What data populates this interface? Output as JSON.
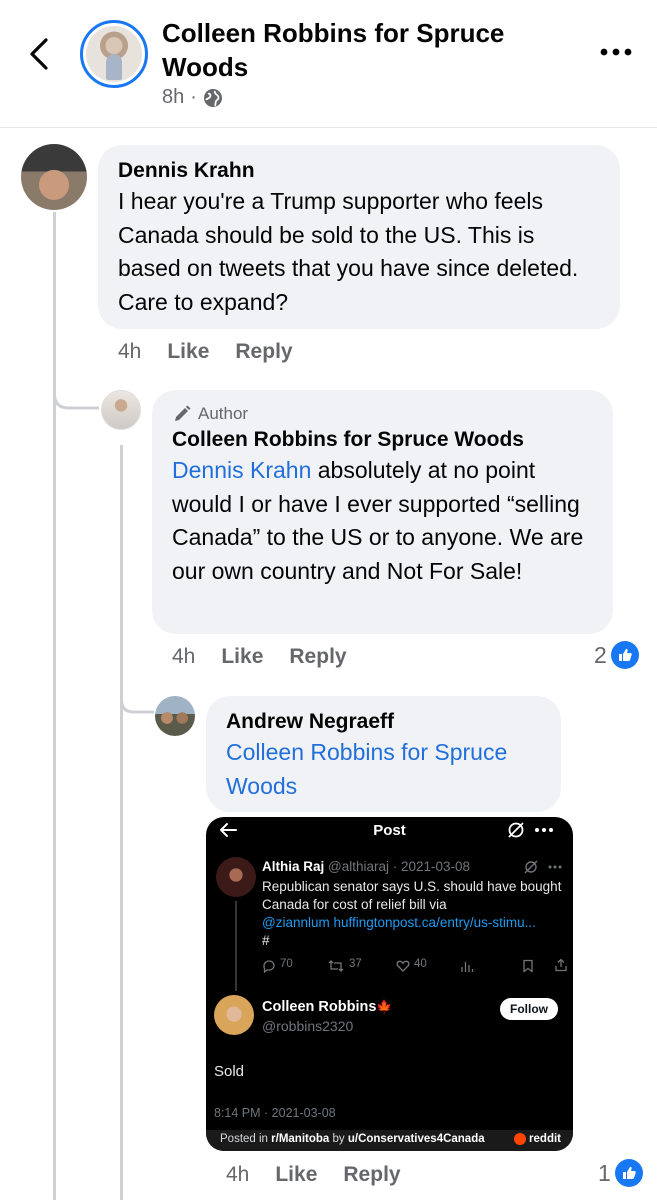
{
  "header": {
    "title": "Colleen Robbins for Spruce Woods",
    "time": "8h",
    "dot": "·"
  },
  "comments": [
    {
      "name": "Dennis Krahn",
      "text": "I hear you're a Trump supporter who feels Canada should be sold to the US. This is based on tweets that you have since deleted. Care to expand?",
      "time": "4h",
      "like": "Like",
      "reply": "Reply"
    },
    {
      "badge": "Author",
      "name": "Colleen Robbins for Spruce Woods",
      "mention": "Dennis Krahn",
      "text": " absolutely at no point would I or have I ever supported “selling Canada” to the US or to anyone. We are our own country and Not For Sale!",
      "time": "4h",
      "like": "Like",
      "reply": "Reply",
      "reaction_count": "2"
    },
    {
      "name": "Andrew Negraeff",
      "mention": "Colleen Robbins for Spruce Woods",
      "time": "4h",
      "like": "Like",
      "reply": "Reply",
      "reaction_count": "1"
    }
  ],
  "embedded": {
    "title": "Post",
    "tweet": {
      "name": "Althia Raj",
      "handle": "@althiaraj · 2021-03-08",
      "text": "Republican senator says U.S. should have bought Canada for cost of relief bill via",
      "link": "@ziannlum huffingtonpost.ca/entry/us-stimu...",
      "hash": "#",
      "replies": "70",
      "retweets": "37",
      "likes": "40"
    },
    "reply": {
      "name": "Colleen Robbins",
      "flag": "🍁",
      "handle": "@robbins2320",
      "follow": "Follow",
      "text": "Sold",
      "date": "8:14 PM · 2021-03-08"
    },
    "reddit": {
      "prefix": "Posted in ",
      "sub": "r/Manitoba",
      "by": " by ",
      "user": "u/Conservatives4Canada",
      "brand": "reddit"
    }
  },
  "colors": {
    "accent": "#1877f2",
    "mention": "#216fdb",
    "bubble": "#f0f2f5",
    "meta": "#65676b"
  }
}
